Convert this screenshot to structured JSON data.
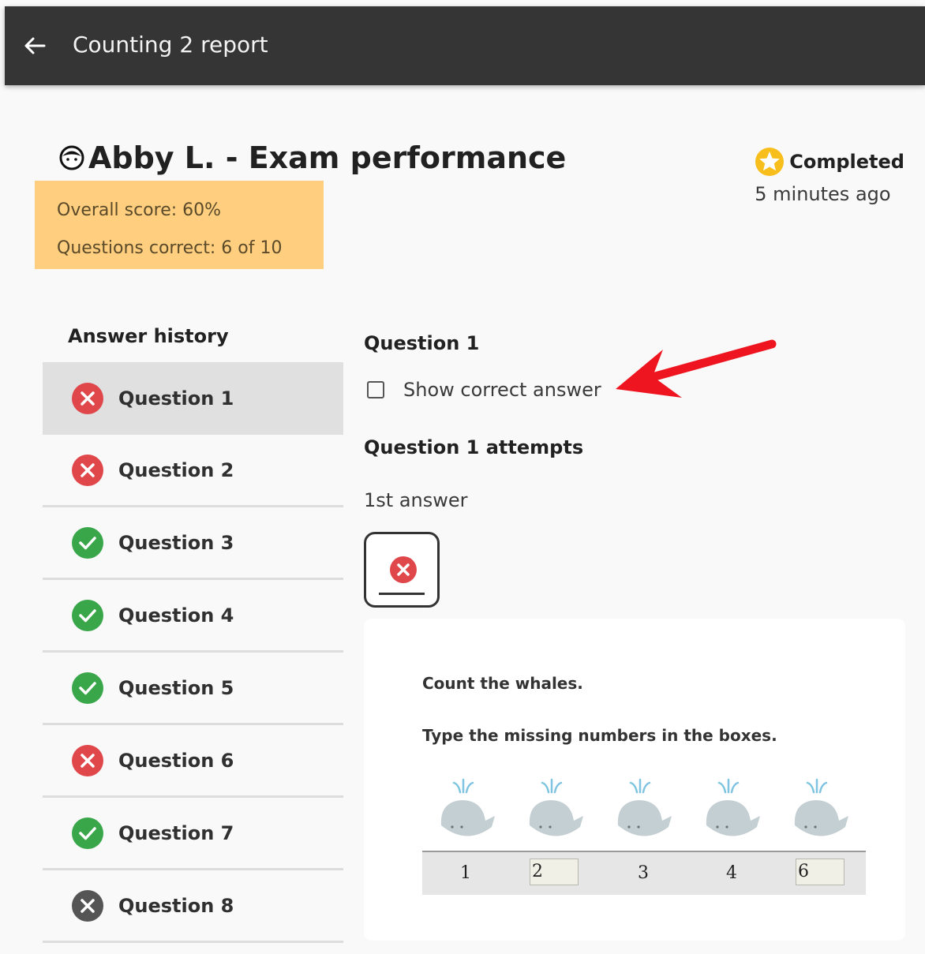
{
  "app_bar": {
    "title": "Counting 2 report"
  },
  "learner": {
    "title": "Abby L. - Exam performance"
  },
  "score": {
    "overall": "Overall score: 60%",
    "correct": "Questions correct: 6 of 10"
  },
  "status": {
    "label": "Completed",
    "time": "5 minutes ago"
  },
  "history": {
    "title": "Answer history",
    "items": [
      {
        "label": "Question 1",
        "result": "incorrect"
      },
      {
        "label": "Question 2",
        "result": "incorrect"
      },
      {
        "label": "Question 3",
        "result": "correct"
      },
      {
        "label": "Question 4",
        "result": "correct"
      },
      {
        "label": "Question 5",
        "result": "correct"
      },
      {
        "label": "Question 6",
        "result": "incorrect"
      },
      {
        "label": "Question 7",
        "result": "correct"
      },
      {
        "label": "Question 8",
        "result": "unanswered"
      }
    ]
  },
  "detail": {
    "title": "Question 1",
    "show_answer_label": "Show correct answer",
    "show_answer_checked": false,
    "attempts_title": "Question 1 attempts",
    "answer_label": "1st answer",
    "question_text_1": "Count the whales.",
    "question_text_2": "Type the missing numbers in the boxes.",
    "numbers": [
      "1",
      "2",
      "3",
      "4",
      "6"
    ]
  },
  "colors": {
    "app_bar": "#353535",
    "score_box": "#ffcf7f",
    "incorrect": "#e0474b",
    "correct": "#3aa64a",
    "unanswered": "#555555",
    "completed_star": "#f7be1c",
    "annotation_arrow": "#ee1520"
  }
}
